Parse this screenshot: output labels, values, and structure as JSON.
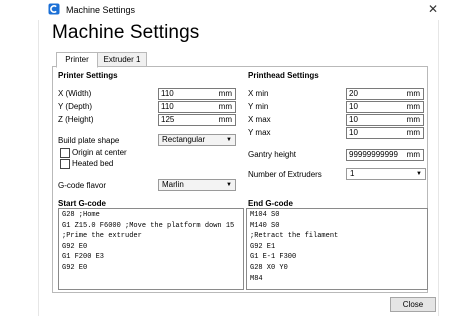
{
  "window": {
    "title": "Machine Settings",
    "close_glyph": "✕",
    "app_icon": "cura-logo-icon"
  },
  "heading": "Machine Settings",
  "tabs": [
    {
      "label": "Printer",
      "active": true
    },
    {
      "label": "Extruder 1",
      "active": false
    }
  ],
  "printer_settings": {
    "title": "Printer Settings",
    "x_width": {
      "label": "X (Width)",
      "value": "110",
      "unit": "mm"
    },
    "y_depth": {
      "label": "Y (Depth)",
      "value": "110",
      "unit": "mm"
    },
    "z_height": {
      "label": "Z (Height)",
      "value": "125",
      "unit": "mm"
    },
    "build_plate_shape": {
      "label": "Build plate shape",
      "value": "Rectangular"
    },
    "origin_at_center": {
      "label": "Origin at center",
      "checked": false
    },
    "heated_bed": {
      "label": "Heated bed",
      "checked": false
    },
    "gcode_flavor": {
      "label": "G-code flavor",
      "value": "Marlin"
    }
  },
  "printhead_settings": {
    "title": "Printhead Settings",
    "x_min": {
      "label": "X min",
      "value": "20",
      "unit": "mm"
    },
    "y_min": {
      "label": "Y min",
      "value": "10",
      "unit": "mm"
    },
    "x_max": {
      "label": "X max",
      "value": "10",
      "unit": "mm"
    },
    "y_max": {
      "label": "Y max",
      "value": "10",
      "unit": "mm"
    },
    "gantry_height": {
      "label": "Gantry height",
      "value": "99999999999",
      "unit": "mm"
    },
    "number_of_extruders": {
      "label": "Number of Extruders",
      "value": "1"
    }
  },
  "start_gcode": {
    "title": "Start G-code",
    "text": "G28 ;Home\nG1 Z15.0 F6000 ;Move the platform down 15\n;Prime the extruder\nG92 E0\nG1 F200 E3\nG92 E0"
  },
  "end_gcode": {
    "title": "End G-code",
    "text": "M104 S0\nM140 S0\n;Retract the filament\nG92 E1\nG1 E-1 F300\nG28 X0 Y0\nM84"
  },
  "footer": {
    "close_label": "Close"
  },
  "colors": {
    "border": "#b9b9b9",
    "tab_inactive": "#f0f0f0",
    "button": "#e5e5e5"
  }
}
